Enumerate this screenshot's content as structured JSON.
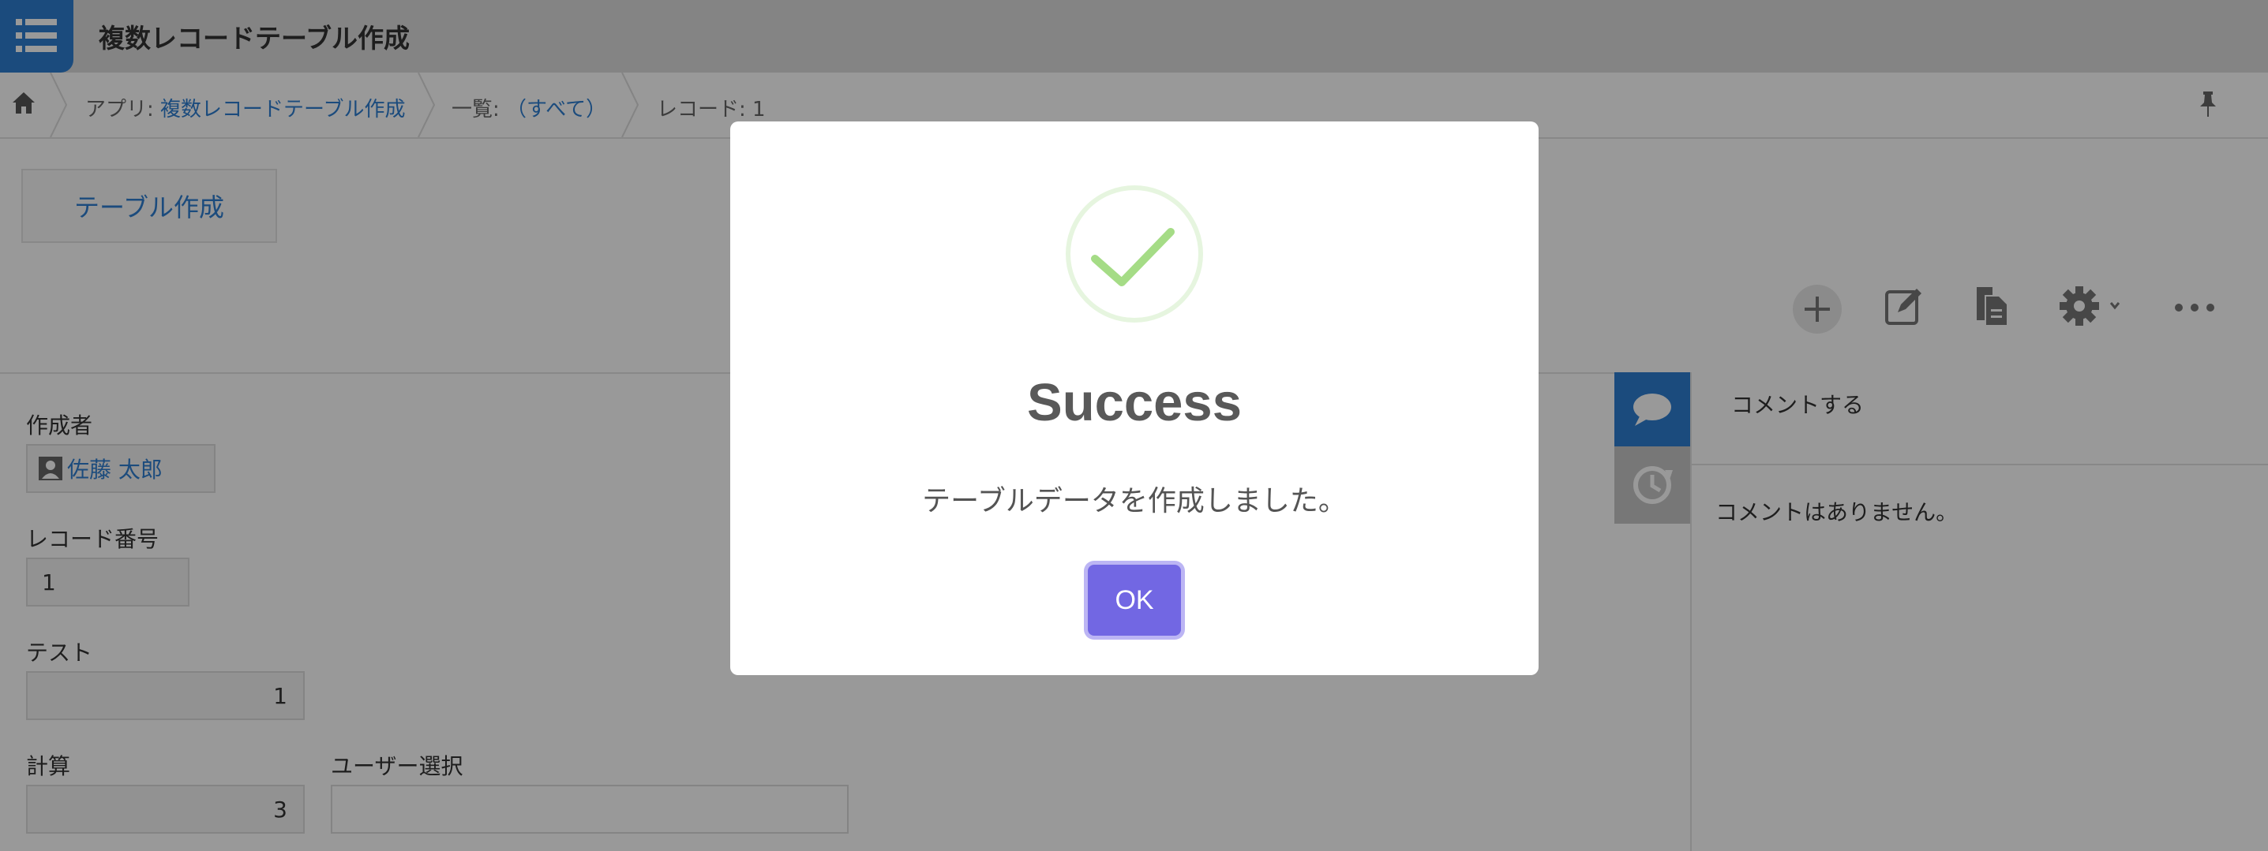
{
  "header": {
    "app_title": "複数レコードテーブル作成"
  },
  "breadcrumb": {
    "app_prefix": "アプリ: ",
    "app_link": "複数レコードテーブル作成",
    "view_prefix": "一覧: ",
    "view_link": "（すべて）",
    "record": "レコード: 1"
  },
  "toolbar": {
    "table_create_label": "テーブル作成",
    "icons": [
      "plus-icon",
      "edit-icon",
      "duplicate-icon",
      "gear-icon",
      "more-icon"
    ]
  },
  "record": {
    "creator_label": "作成者",
    "creator_value": "佐藤 太郎",
    "record_number_label": "レコード番号",
    "record_number_value": "1",
    "test_label": "テスト",
    "test_value": "1",
    "calc_label": "計算",
    "calc_value": "3",
    "user_select_label": "ユーザー選択",
    "user_select_value": ""
  },
  "side_panel": {
    "comment_placeholder": "コメントする",
    "no_comments": "コメントはありません。"
  },
  "modal": {
    "title": "Success",
    "message": "テーブルデータを作成しました。",
    "ok_label": "OK",
    "icon": "check-icon"
  },
  "colors": {
    "accent": "#2e7ed0",
    "ok_button": "#7267e3",
    "success_check": "#a5dc86"
  }
}
